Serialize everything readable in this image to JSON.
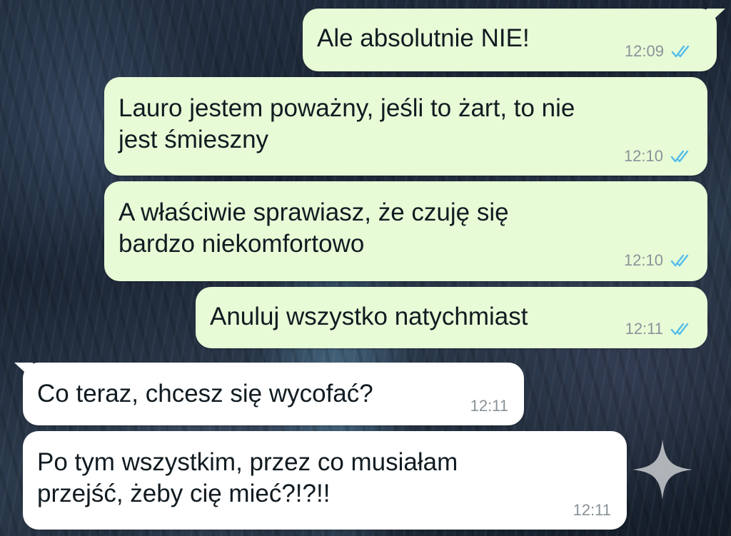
{
  "messages": [
    {
      "direction": "outgoing",
      "text": "Ale absolutnie NIE!",
      "time": "12:09",
      "status": "read-double-check"
    },
    {
      "direction": "outgoing",
      "text": "Lauro jestem poważny, jeśli to żart, to nie\njest śmieszny",
      "time": "12:10",
      "status": "read-double-check"
    },
    {
      "direction": "outgoing",
      "text": "A właściwie sprawiasz, że czuję się\nbardzo niekomfortowo",
      "time": "12:10",
      "status": "read-double-check"
    },
    {
      "direction": "outgoing",
      "text": "Anuluj wszystko natychmiast",
      "time": "12:11",
      "status": "read-double-check"
    },
    {
      "direction": "incoming",
      "text": "Co teraz, chcesz się wycofać?",
      "time": "12:11"
    },
    {
      "direction": "incoming",
      "text": "Po tym wszystkim, przez co musiałam\nprzejść, żeby cię mieć?!?!!",
      "time": "12:11"
    }
  ],
  "icons": {
    "read_receipt": "double-check-icon",
    "overlay": "sparkle-icon"
  },
  "colors": {
    "outgoing_bubble": "#e7fbd7",
    "incoming_bubble": "#ffffff",
    "read_tick": "#53bdeb",
    "timestamp": "#8a9297"
  }
}
